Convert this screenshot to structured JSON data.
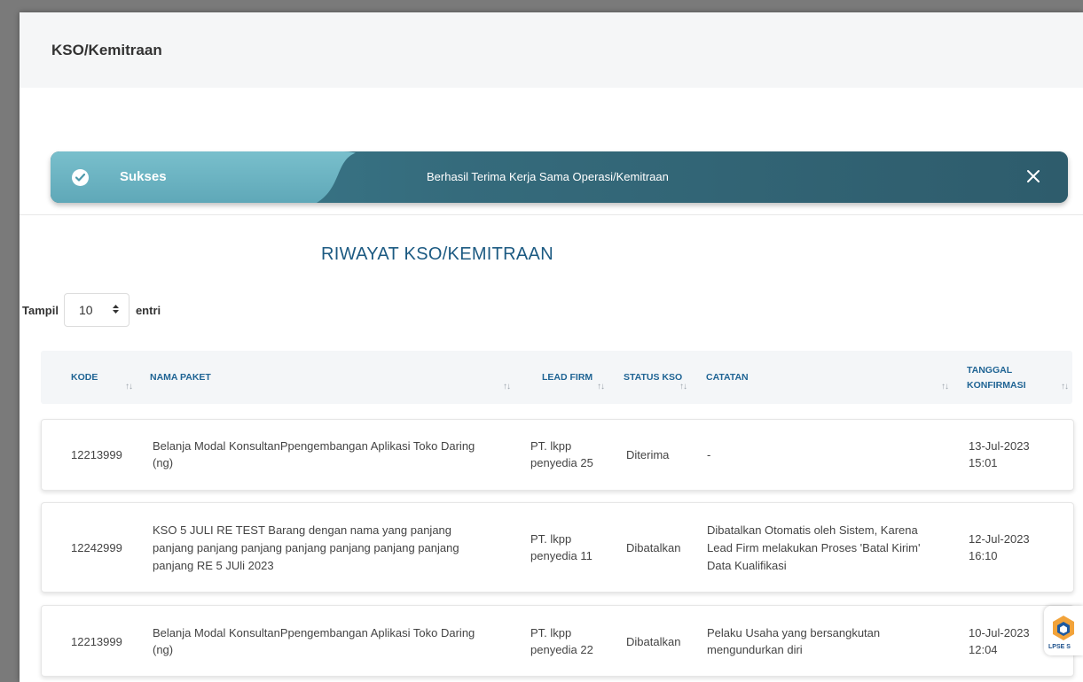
{
  "page": {
    "title": "KSO/Kemitraan"
  },
  "alert": {
    "title": "Sukses",
    "message": "Berhasil Terima Kerja Sama Operasi/Kemitraan",
    "icon": "check-circle-icon",
    "close_icon": "close-icon",
    "colors": {
      "accent_light": "#79bfcc",
      "accent_dark": "#2e5c6c"
    }
  },
  "section": {
    "title": "RIWAYAT KSO/KEMITRAAN",
    "title_color": "#1c5a82"
  },
  "length_control": {
    "prefix": "Tampil",
    "value": "10",
    "suffix": "entri"
  },
  "table": {
    "columns": {
      "kode": "KODE",
      "nama_paket": "NAMA PAKET",
      "lead_firm": "LEAD FIRM",
      "status_kso": "STATUS KSO",
      "catatan": "CATATAN",
      "tanggal_1": "TANGGAL",
      "tanggal_2": "KONFIRMASI"
    },
    "rows": [
      {
        "kode": "12213999",
        "nama_paket_1": "Belanja Modal KonsultanPpengembangan Aplikasi Toko Daring",
        "nama_paket_2": "(ng)",
        "lead_firm_1": "PT. lkpp",
        "lead_firm_2": "penyedia 25",
        "status": "Diterima",
        "catatan_1": "-",
        "tanggal_1": "13-Jul-2023",
        "tanggal_2": "15:01"
      },
      {
        "kode": "12242999",
        "nama_paket_1": "KSO 5 JULI RE TEST Barang dengan nama yang panjang",
        "nama_paket_2": "panjang panjang panjang panjang panjang panjang panjang",
        "nama_paket_3": "panjang RE 5 JUli 2023",
        "lead_firm_1": "PT. lkpp",
        "lead_firm_2": "penyedia 11",
        "status": "Dibatalkan",
        "catatan_1": "Dibatalkan Otomatis oleh Sistem, Karena",
        "catatan_2": "Lead Firm melakukan Proses 'Batal Kirim'",
        "catatan_3": "Data Kualifikasi",
        "tanggal_1": "12-Jul-2023",
        "tanggal_2": "16:10"
      },
      {
        "kode": "12213999",
        "nama_paket_1": "Belanja Modal KonsultanPpengembangan Aplikasi Toko Daring",
        "nama_paket_2": "(ng)",
        "lead_firm_1": "PT. lkpp",
        "lead_firm_2": "penyedia 22",
        "status": "Dibatalkan",
        "catatan_1": "Pelaku Usaha yang bersangkutan",
        "catatan_2": "mengundurkan diri",
        "tanggal_1": "10-Jul-2023",
        "tanggal_2": "12:04"
      }
    ]
  },
  "badge": {
    "text": "LPSE S",
    "icon": "lpse-logo-icon"
  }
}
